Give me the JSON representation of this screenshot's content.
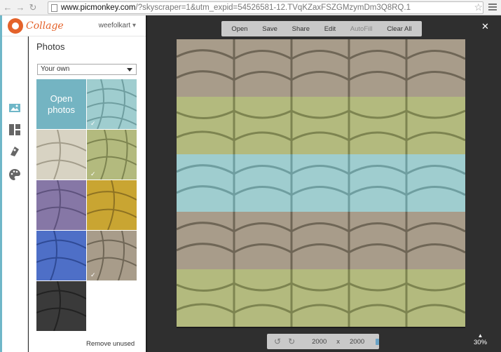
{
  "browser": {
    "url_host": "www.picmonkey.com",
    "url_rest": "/?skyscraper=1&utm_expid=54526581-12.TVqKZaxFSZGMzymDm3Q8RQ.1"
  },
  "app": {
    "logo": "Collage",
    "user": "weefolkart"
  },
  "panel": {
    "title": "Photos",
    "source_select": "Your own",
    "open_tile_label": "Open photos",
    "remove_link": "Remove unused"
  },
  "toolbar": {
    "open": "Open",
    "save": "Save",
    "share": "Share",
    "edit": "Edit",
    "autofill": "AutoFill",
    "clear_all": "Clear All"
  },
  "canvas": {
    "width": "2000",
    "x": "x",
    "height": "2000",
    "zoom": "30%"
  },
  "colors": {
    "accent": "#74b4c2",
    "logo": "#e4622a",
    "yarn_tan": "#a89c8a",
    "yarn_green": "#b3ba7e",
    "yarn_blue": "#9fcdcf",
    "yarn_purple": "#8677a6",
    "yarn_gold": "#c9a532",
    "yarn_royal": "#4e6fc7",
    "yarn_black": "#3a3a3a",
    "yarn_cream": "#d8d3c3"
  }
}
